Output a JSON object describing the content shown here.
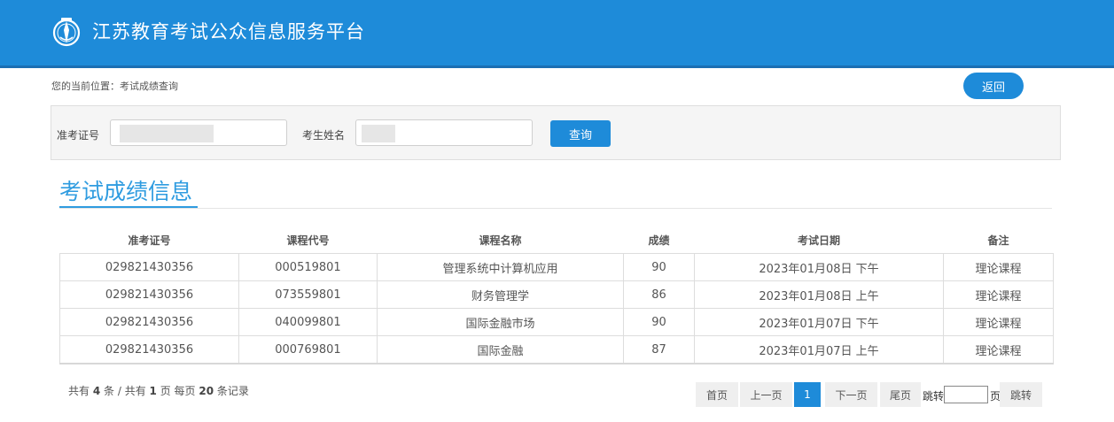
{
  "header": {
    "title": "江苏教育考试公众信息服务平台",
    "logo_icon": "education-emblem-icon",
    "bg_color": "#1e8bd9"
  },
  "breadcrumb": "您的当前位置：考试成绩查询",
  "back_button": "返回",
  "search": {
    "ticket_label": "准考证号",
    "name_label": "考生姓名",
    "query_button": "查询"
  },
  "section_title": "考试成绩信息",
  "table": {
    "headers": [
      "准考证号",
      "课程代号",
      "课程名称",
      "成绩",
      "考试日期",
      "备注"
    ],
    "rows": [
      [
        "029821430356",
        "000519801",
        "管理系统中计算机应用",
        "90",
        "2023年01月08日 下午",
        "理论课程"
      ],
      [
        "029821430356",
        "073559801",
        "财务管理学",
        "86",
        "2023年01月08日 上午",
        "理论课程"
      ],
      [
        "029821430356",
        "040099801",
        "国际金融市场",
        "90",
        "2023年01月07日 下午",
        "理论课程"
      ],
      [
        "029821430356",
        "000769801",
        "国际金融",
        "87",
        "2023年01月07日 上午",
        "理论课程"
      ]
    ]
  },
  "summary": {
    "total_prefix": "共有",
    "total_count": "4",
    "total_unit": "条 / 共有",
    "pages_count": "1",
    "pages_unit": "页 每页",
    "per_page": "20",
    "per_page_unit": "条记录"
  },
  "pagination": {
    "first": "首页",
    "prev": "上一页",
    "current": "1",
    "next": "下一页",
    "last": "尾页",
    "jump_label": "跳转",
    "page_suffix": "页",
    "jump_button": "跳转"
  }
}
